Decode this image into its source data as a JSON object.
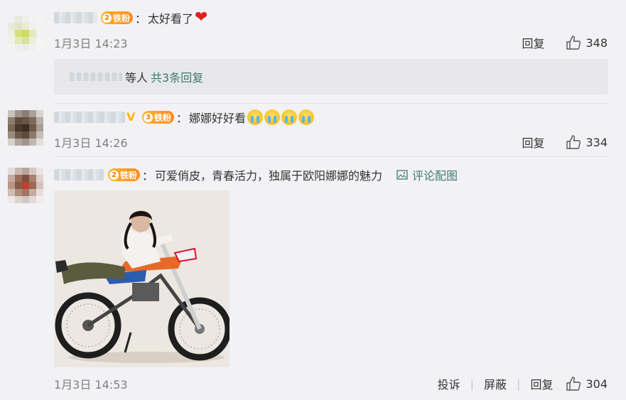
{
  "comments": [
    {
      "fan_level": "2",
      "fan_label": "铁粉",
      "text": "太好看了",
      "emoji": "❤",
      "time": "1月3日 14:23",
      "reply_label": "回复",
      "likes": "348"
    },
    {
      "fan_level": "3",
      "fan_label": "铁粉",
      "text": "娜娜好好看",
      "emoji_name": "crying-face-icon",
      "emoji_count": 4,
      "time": "1月3日 14:26",
      "reply_label": "回复",
      "likes": "334"
    },
    {
      "fan_level": "2",
      "fan_label": "铁粉",
      "text": "可爱俏皮，青春活力，独属于欧阳娜娜的魅力",
      "pic_link": "评论配图",
      "time": "1月3日 14:53",
      "report_label": "投诉",
      "block_label": "屏蔽",
      "reply_label": "回复",
      "likes": "304"
    }
  ],
  "reply_summary": {
    "prefix": "等人",
    "link": "共3条回复"
  },
  "colors": {
    "background": "#f2f2f5",
    "link": "#3d7a72",
    "meta": "#808080",
    "heart": "#e02020",
    "badge": "#ff8a1e"
  }
}
